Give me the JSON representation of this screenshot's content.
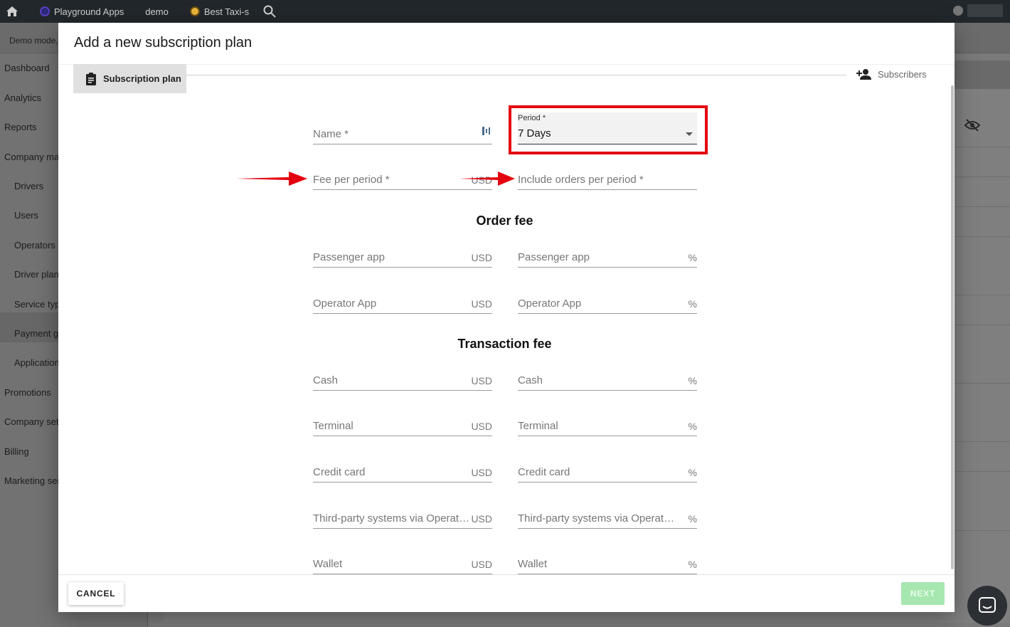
{
  "topbar": {
    "crumbs": [
      {
        "label": "Playground Apps"
      },
      {
        "label": "demo"
      },
      {
        "label": "Best Taxi-s"
      }
    ]
  },
  "background": {
    "demo_text": "Demo mode,",
    "sidebar": [
      {
        "label": "Dashboard"
      },
      {
        "label": "Analytics"
      },
      {
        "label": "Reports"
      },
      {
        "label": "Company ma"
      },
      {
        "label": "Drivers"
      },
      {
        "label": "Users"
      },
      {
        "label": "Operators"
      },
      {
        "label": "Driver plans"
      },
      {
        "label": "Service typ"
      },
      {
        "label": "Payment ga"
      },
      {
        "label": "Application"
      },
      {
        "label": "Promotions"
      },
      {
        "label": "Company set"
      },
      {
        "label": "Billing"
      },
      {
        "label": "Marketing ser"
      }
    ]
  },
  "dialog": {
    "title": "Add a new subscription plan",
    "steps": {
      "active": "Subscription plan",
      "next": "Subscribers"
    },
    "fields": {
      "name": "Name *",
      "period_label": "Period *",
      "period_value": "7 Days",
      "fee_per_period": "Fee per period *",
      "fee_unit": "USD",
      "include_orders": "Include orders per period *"
    },
    "sections": {
      "order_fee": "Order fee",
      "transaction_fee": "Transaction fee"
    },
    "order_fee_rows": [
      {
        "label": "Passenger app",
        "unit_left": "USD",
        "unit_right": "%"
      },
      {
        "label": "Operator App",
        "unit_left": "USD",
        "unit_right": "%"
      }
    ],
    "transaction_fee_rows": [
      {
        "label": "Cash",
        "unit_left": "USD",
        "unit_right": "%"
      },
      {
        "label": "Terminal",
        "unit_left": "USD",
        "unit_right": "%"
      },
      {
        "label": "Credit card",
        "unit_left": "USD",
        "unit_right": "%"
      },
      {
        "label": "Third-party systems via Operator App",
        "unit_left": "USD",
        "unit_right": "%"
      },
      {
        "label": "Wallet",
        "unit_left": "USD",
        "unit_right": "%"
      }
    ],
    "buttons": {
      "cancel": "CANCEL",
      "next": "NEXT"
    }
  },
  "colors": {
    "highlight": "#e3000f",
    "next_disabled": "#a6e7b0",
    "topbar": "#22272b"
  }
}
